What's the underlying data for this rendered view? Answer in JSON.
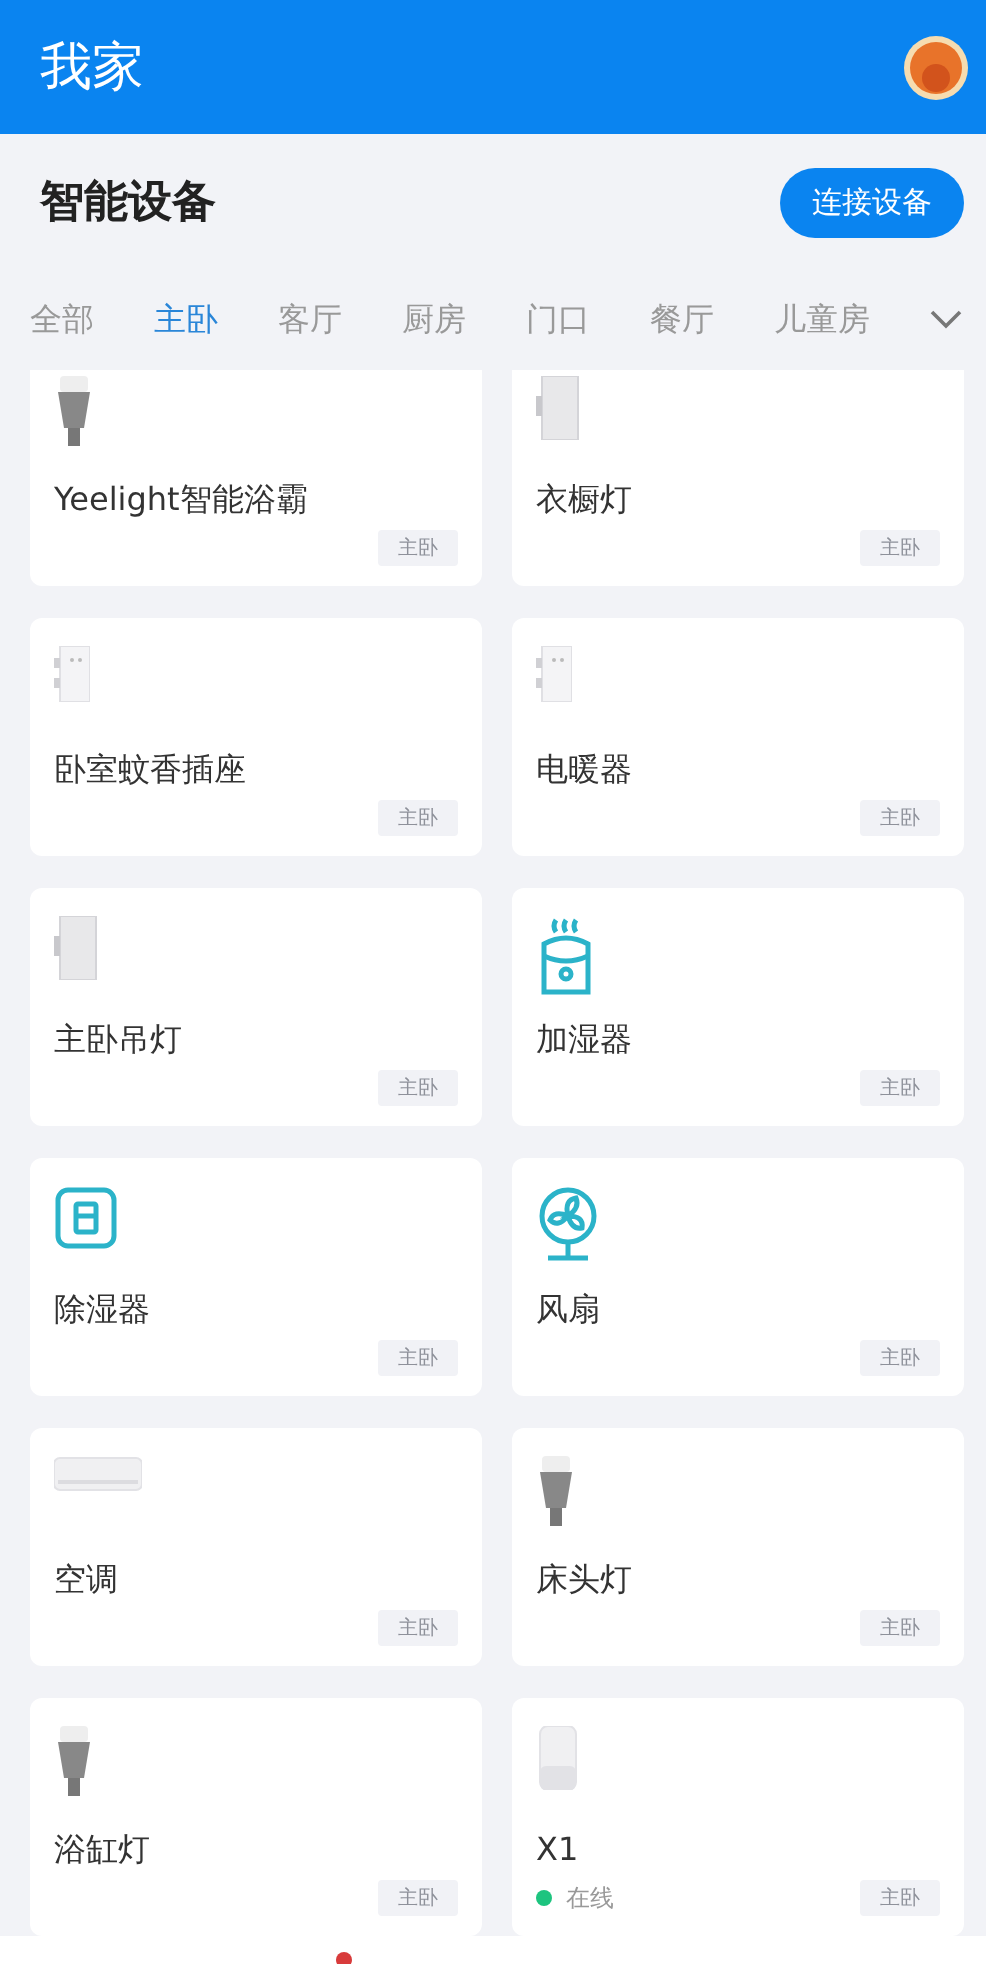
{
  "header": {
    "title": "我家"
  },
  "section": {
    "title": "智能设备",
    "button": "连接设备"
  },
  "tabs": [
    {
      "label": "全部",
      "selected": false
    },
    {
      "label": "主卧",
      "selected": true
    },
    {
      "label": "客厅",
      "selected": false
    },
    {
      "label": "厨房",
      "selected": false
    },
    {
      "label": "门口",
      "selected": false
    },
    {
      "label": "餐厅",
      "selected": false
    },
    {
      "label": "儿童房",
      "selected": false
    }
  ],
  "devices": [
    {
      "name": "Yeelight智能浴霸",
      "kind": "bulb",
      "room": "主卧"
    },
    {
      "name": "衣橱灯",
      "kind": "switch",
      "room": "主卧"
    },
    {
      "name": "卧室蚊香插座",
      "kind": "socket",
      "room": "主卧"
    },
    {
      "name": "电暖器",
      "kind": "socket",
      "room": "主卧"
    },
    {
      "name": "主卧吊灯",
      "kind": "switch",
      "room": "主卧"
    },
    {
      "name": "加湿器",
      "kind": "humidifier",
      "room": "主卧"
    },
    {
      "name": "除湿器",
      "kind": "dehumidifier",
      "room": "主卧"
    },
    {
      "name": "风扇",
      "kind": "fan",
      "room": "主卧"
    },
    {
      "name": "空调",
      "kind": "ac",
      "room": "主卧"
    },
    {
      "name": "床头灯",
      "kind": "bulb",
      "room": "主卧"
    },
    {
      "name": "浴缸灯",
      "kind": "bulb",
      "room": "主卧"
    },
    {
      "name": "X1",
      "kind": "speaker",
      "room": "主卧",
      "status": {
        "text": "在线",
        "color": "#1dc47f"
      }
    }
  ]
}
